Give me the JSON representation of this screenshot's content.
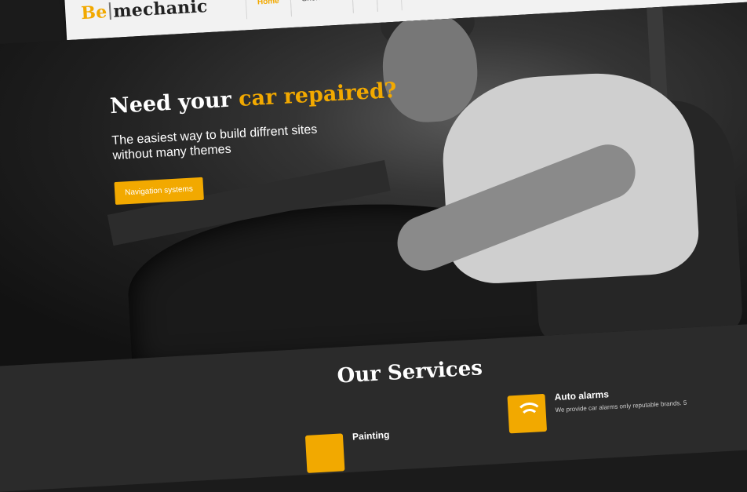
{
  "brand": {
    "logo_prefix": "Be",
    "logo_suffix": "mechanic"
  },
  "nav": {
    "items": [
      "Home",
      "Shortcodes",
      "",
      ""
    ]
  },
  "hero": {
    "title_plain": "Need your ",
    "title_accent": "car repaired?",
    "subtitle": "The easiest way to build diffrent sites without many themes",
    "button_label": "Navigation systems"
  },
  "services": {
    "title": "Our Services",
    "items": [
      {
        "name": "Auto alarms",
        "icon": "signal-wave-icon",
        "description": "We provide car alarms only reputable brands. 5"
      },
      {
        "name": "Painting",
        "icon": "paint-icon"
      }
    ]
  },
  "colors": {
    "accent": "#f2a900",
    "dark": "#1b1b1b",
    "services_bg": "#2b2b2b"
  }
}
